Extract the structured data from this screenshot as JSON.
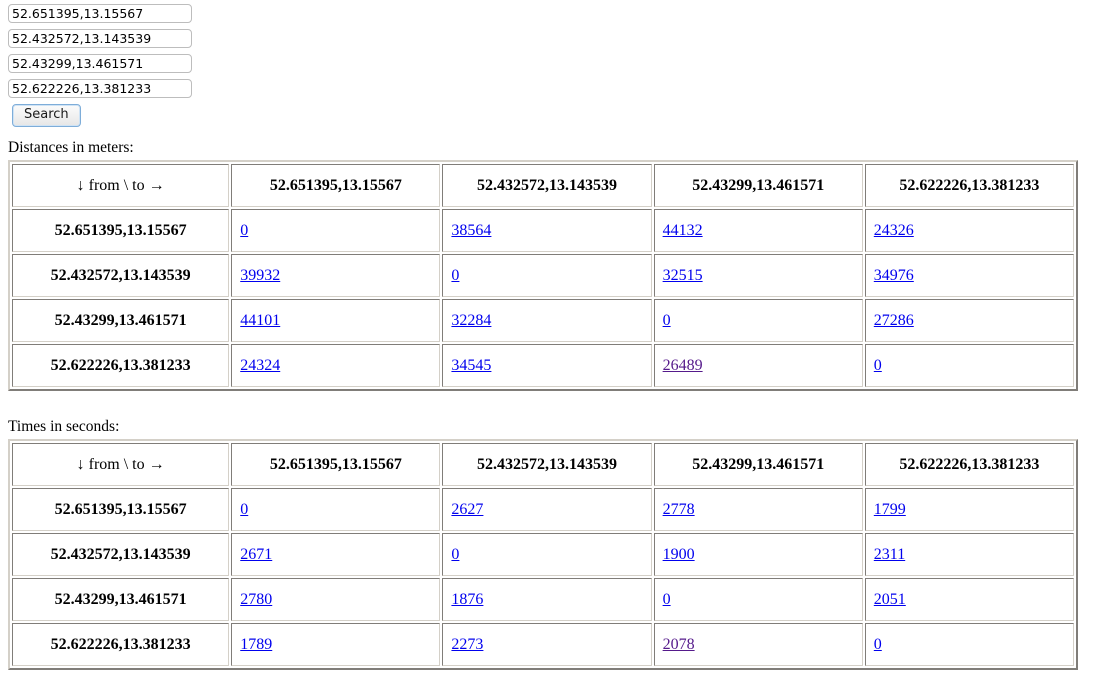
{
  "form": {
    "inputs": [
      {
        "name": "origin-1",
        "value": "52.651395,13.15567",
        "placeholder": "lat,lon"
      },
      {
        "name": "origin-2",
        "value": "52.432572,13.143539",
        "placeholder": "lat,lon"
      },
      {
        "name": "origin-3",
        "value": "52.43299,13.461571",
        "placeholder": "lat,lon"
      },
      {
        "name": "origin-4",
        "value": "52.622226,13.381233",
        "placeholder": "lat,lon"
      }
    ],
    "search_label": "Search"
  },
  "colors": {
    "link": "#0000ee",
    "visited_link": "#551a8b",
    "text": "#000000",
    "background": "#ffffff"
  },
  "distances": {
    "label": "Distances in meters:",
    "corner_label": "↓ from \\ to →",
    "columns": [
      "52.651395,13.15567",
      "52.432572,13.143539",
      "52.43299,13.461571",
      "52.622226,13.381233"
    ],
    "rows": [
      {
        "label": "52.651395,13.15567",
        "cells": [
          {
            "value": "0",
            "visited": false
          },
          {
            "value": "38564",
            "visited": false
          },
          {
            "value": "44132",
            "visited": false
          },
          {
            "value": "24326",
            "visited": false
          }
        ]
      },
      {
        "label": "52.432572,13.143539",
        "cells": [
          {
            "value": "39932",
            "visited": false
          },
          {
            "value": "0",
            "visited": false
          },
          {
            "value": "32515",
            "visited": false
          },
          {
            "value": "34976",
            "visited": false
          }
        ]
      },
      {
        "label": "52.43299,13.461571",
        "cells": [
          {
            "value": "44101",
            "visited": false
          },
          {
            "value": "32284",
            "visited": false
          },
          {
            "value": "0",
            "visited": false
          },
          {
            "value": "27286",
            "visited": false
          }
        ]
      },
      {
        "label": "52.622226,13.381233",
        "cells": [
          {
            "value": "24324",
            "visited": false
          },
          {
            "value": "34545",
            "visited": false
          },
          {
            "value": "26489",
            "visited": true
          },
          {
            "value": "0",
            "visited": false
          }
        ]
      }
    ]
  },
  "times": {
    "label": "Times in seconds:",
    "corner_label": "↓ from \\ to →",
    "columns": [
      "52.651395,13.15567",
      "52.432572,13.143539",
      "52.43299,13.461571",
      "52.622226,13.381233"
    ],
    "rows": [
      {
        "label": "52.651395,13.15567",
        "cells": [
          {
            "value": "0",
            "visited": false
          },
          {
            "value": "2627",
            "visited": false
          },
          {
            "value": "2778",
            "visited": false
          },
          {
            "value": "1799",
            "visited": false
          }
        ]
      },
      {
        "label": "52.432572,13.143539",
        "cells": [
          {
            "value": "2671",
            "visited": false
          },
          {
            "value": "0",
            "visited": false
          },
          {
            "value": "1900",
            "visited": false
          },
          {
            "value": "2311",
            "visited": false
          }
        ]
      },
      {
        "label": "52.43299,13.461571",
        "cells": [
          {
            "value": "2780",
            "visited": false
          },
          {
            "value": "1876",
            "visited": false
          },
          {
            "value": "0",
            "visited": false
          },
          {
            "value": "2051",
            "visited": false
          }
        ]
      },
      {
        "label": "52.622226,13.381233",
        "cells": [
          {
            "value": "1789",
            "visited": false
          },
          {
            "value": "2273",
            "visited": false
          },
          {
            "value": "2078",
            "visited": true
          },
          {
            "value": "0",
            "visited": false
          }
        ]
      }
    ]
  }
}
